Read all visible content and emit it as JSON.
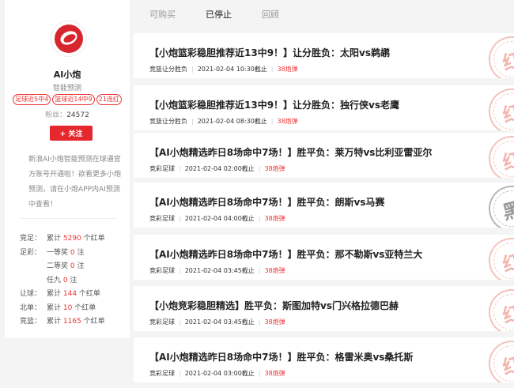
{
  "profile": {
    "name": "AI小炮",
    "subtitle": "智能预测",
    "badges": [
      "足球近5中4",
      "篮球近14中9",
      "21连红"
    ],
    "fans_label": "粉丝：",
    "fans_count": "24572",
    "follow_label": "+ 关注",
    "description": "新浪AI小炮智能预测在球通官方账号开通啦！欲看更多小炮预测，请在小炮APP内AI预测中查看！",
    "stats": [
      {
        "label": "竞足：",
        "prefix": "累计 ",
        "num": "5290",
        "suffix": " 个红单"
      },
      {
        "label": "足彩：",
        "prefix": "一等奖 ",
        "num": "0",
        "suffix": " 注"
      },
      {
        "label": "",
        "prefix": "二等奖 ",
        "num": "0",
        "suffix": " 注"
      },
      {
        "label": "",
        "prefix": "任九 ",
        "num": "0",
        "suffix": " 注"
      },
      {
        "label": "让球：",
        "prefix": "累计 ",
        "num": "144",
        "suffix": " 个红单"
      },
      {
        "label": "北单：",
        "prefix": "累计 ",
        "num": "10",
        "suffix": " 个红单"
      },
      {
        "label": "竞篮：",
        "prefix": "累计 ",
        "num": "1165",
        "suffix": " 个红单"
      }
    ]
  },
  "tabs": [
    {
      "label": "可购买",
      "active": false
    },
    {
      "label": "已停止",
      "active": true
    },
    {
      "label": "回顾",
      "active": false
    }
  ],
  "cards": [
    {
      "title": "【小炮篮彩稳胆推荐近13中9！】让分胜负：太阳vs鹈鹕",
      "category": "竞篮让分胜负",
      "time": "2021-02-04 10:30截止",
      "price": "38炮弹",
      "stamp": "红",
      "stamp_color": "red"
    },
    {
      "title": "【小炮篮彩稳胆推荐近13中9！】让分胜负：独行侠vs老鹰",
      "category": "竞篮让分胜负",
      "time": "2021-02-04 08:30截止",
      "price": "38炮弹",
      "stamp": "红",
      "stamp_color": "red"
    },
    {
      "title": "【AI小炮精选昨日8场命中7场！】胜平负：莱万特vs比利亚雷亚尔",
      "category": "竞彩足球",
      "time": "2021-02-04 02:00截止",
      "price": "38炮弹",
      "stamp": "红",
      "stamp_color": "red"
    },
    {
      "title": "【AI小炮精选昨日8场命中7场！】胜平负：朗斯vs马赛",
      "category": "竞彩足球",
      "time": "2021-02-04 04:00截止",
      "price": "38炮弹",
      "stamp": "黑",
      "stamp_color": "black"
    },
    {
      "title": "【AI小炮精选昨日8场命中7场！】胜平负：那不勒斯vs亚特兰大",
      "category": "竞彩足球",
      "time": "2021-02-04 03:45截止",
      "price": "38炮弹",
      "stamp": "红",
      "stamp_color": "red"
    },
    {
      "title": "【小炮竞彩稳胆精选】胜平负：斯图加特vs门兴格拉德巴赫",
      "category": "竞彩足球",
      "time": "2021-02-04 03:45截止",
      "price": "38炮弹",
      "stamp": "红",
      "stamp_color": "red"
    },
    {
      "title": "【AI小炮精选昨日8场命中7场！】胜平负：格雷米奥vs桑托斯",
      "category": "竞彩足球",
      "time": "2021-02-04 03:00截止",
      "price": "38炮弹",
      "stamp": "红",
      "stamp_color": "red"
    }
  ]
}
